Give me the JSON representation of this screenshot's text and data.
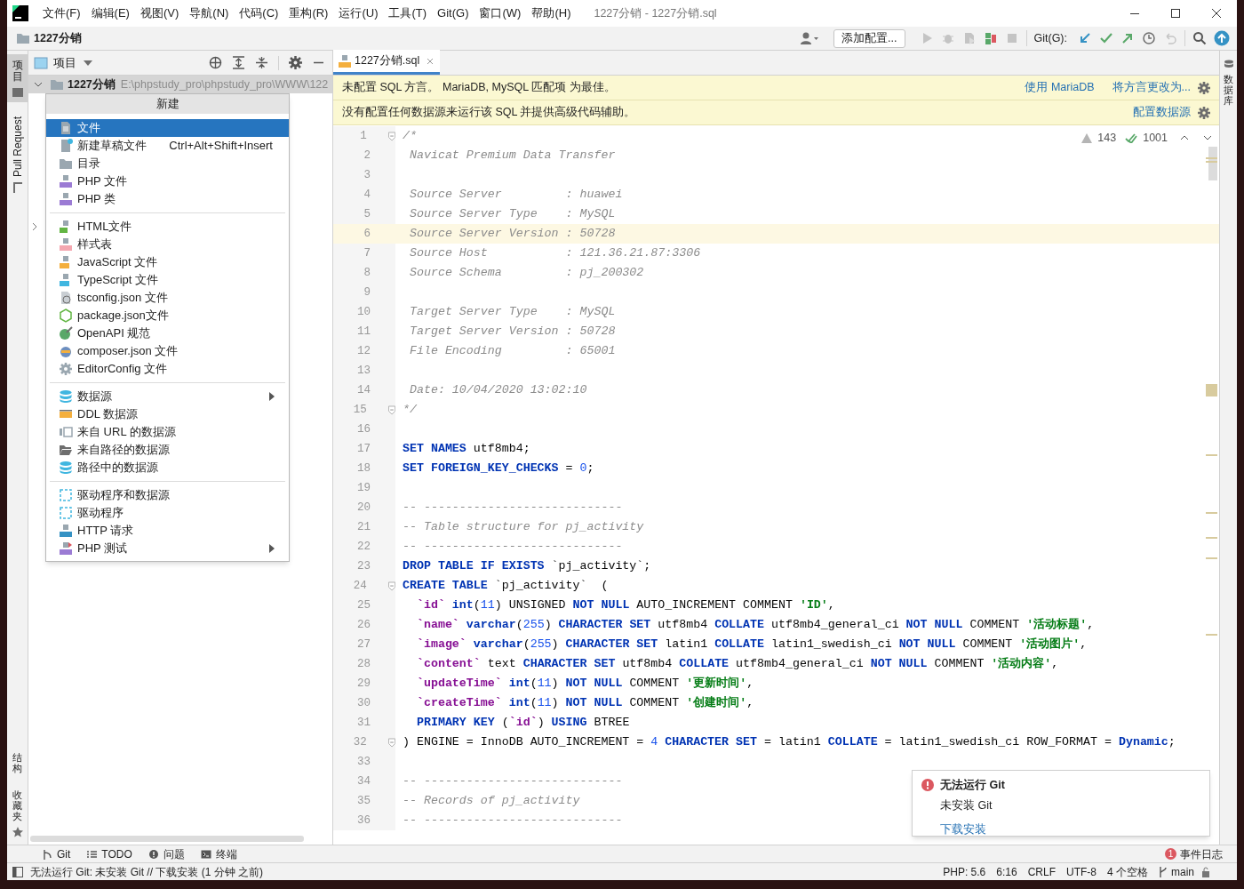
{
  "window": {
    "title": "1227分销 - 1227分销.sql"
  },
  "menu": [
    "文件(F)",
    "编辑(E)",
    "视图(V)",
    "导航(N)",
    "代码(C)",
    "重构(R)",
    "运行(U)",
    "工具(T)",
    "Git(G)",
    "窗口(W)",
    "帮助(H)"
  ],
  "nav_bar": {
    "project": "1227分销",
    "run_config": "添加配置...",
    "git_label": "Git(G):"
  },
  "left_stripe": {
    "top": [
      {
        "label": "项目",
        "vertical_cjk": true,
        "selected": true
      },
      {
        "label": "Pull Request",
        "vertical_cjk": false,
        "selected": false
      }
    ],
    "bottom": [
      {
        "label": "结构"
      },
      {
        "label": "收藏夹"
      }
    ]
  },
  "project_panel": {
    "title": "项目",
    "root": {
      "name": "1227分销",
      "path": "E:\\phpstudy_pro\\phpstudy_pro\\WWW\\122"
    }
  },
  "new_menu": {
    "title": "新建",
    "groups": [
      [
        {
          "kind": "file",
          "label": "文件",
          "selected": true,
          "submenu": false
        },
        {
          "kind": "scratch",
          "label": "新建草稿文件",
          "shortcut": "Ctrl+Alt+Shift+Insert",
          "selected": false,
          "submenu": false
        },
        {
          "kind": "folder",
          "label": "目录",
          "selected": false,
          "submenu": false
        },
        {
          "kind": "php",
          "label": "PHP 文件",
          "selected": false,
          "submenu": false
        },
        {
          "kind": "php",
          "label": "PHP 类",
          "selected": false,
          "submenu": false
        }
      ],
      [
        {
          "kind": "html",
          "label": "HTML文件",
          "selected": false,
          "submenu": false
        },
        {
          "kind": "css",
          "label": "样式表",
          "selected": false,
          "submenu": false
        },
        {
          "kind": "js",
          "label": "JavaScript 文件",
          "selected": false,
          "submenu": false
        },
        {
          "kind": "ts",
          "label": "TypeScript 文件",
          "selected": false,
          "submenu": false
        },
        {
          "kind": "tsconfig",
          "label": "tsconfig.json 文件",
          "selected": false,
          "submenu": false
        },
        {
          "kind": "nodejs",
          "label": "package.json文件",
          "selected": false,
          "submenu": false
        },
        {
          "kind": "openapi",
          "label": "OpenAPI 规范",
          "selected": false,
          "submenu": false
        },
        {
          "kind": "composer",
          "label": "composer.json 文件",
          "selected": false,
          "submenu": false
        },
        {
          "kind": "gear",
          "label": "EditorConfig 文件",
          "selected": false,
          "submenu": false
        }
      ],
      [
        {
          "kind": "database",
          "label": "数据源",
          "selected": false,
          "submenu": true
        },
        {
          "kind": "ddl",
          "label": "DDL 数据源",
          "selected": false,
          "submenu": false
        },
        {
          "kind": "url",
          "label": "来自 URL 的数据源",
          "selected": false,
          "submenu": false
        },
        {
          "kind": "openfolder",
          "label": "来自路径的数据源",
          "selected": false,
          "submenu": false
        },
        {
          "kind": "database",
          "label": "路径中的数据源",
          "selected": false,
          "submenu": false
        }
      ],
      [
        {
          "kind": "driver",
          "label": "驱动程序和数据源",
          "selected": false,
          "submenu": false
        },
        {
          "kind": "driver",
          "label": "驱动程序",
          "selected": false,
          "submenu": false
        },
        {
          "kind": "api",
          "label": "HTTP 请求",
          "selected": false,
          "submenu": false
        },
        {
          "kind": "phptest",
          "label": "PHP 测试",
          "selected": false,
          "submenu": true
        }
      ]
    ]
  },
  "editor": {
    "tab": {
      "label": "1227分销.sql",
      "selected": true
    },
    "banners": [
      {
        "text": "未配置 SQL 方言。 MariaDB, MySQL 匹配项 为最佳。",
        "actions": [
          "使用 MariaDB",
          "将方言更改为..."
        ]
      },
      {
        "text": "没有配置任何数据源来运行该 SQL 并提供高级代码辅助。",
        "actions": [
          "配置数据源"
        ]
      }
    ],
    "inspections": {
      "warnings": "143",
      "checks": "1001"
    },
    "lines": [
      {
        "number": "1",
        "current": false,
        "fold": true,
        "tokens": [
          {
            "kind": "comment",
            "text": "/*"
          }
        ]
      },
      {
        "number": "2",
        "current": false,
        "fold": false,
        "tokens": [
          {
            "kind": "comment",
            "text": " Navicat Premium Data Transfer"
          }
        ]
      },
      {
        "number": "3",
        "current": false,
        "fold": false
      },
      {
        "number": "4",
        "current": false,
        "fold": false,
        "tokens": [
          {
            "kind": "comment",
            "text": " Source Server         : huawei"
          }
        ]
      },
      {
        "number": "5",
        "current": false,
        "fold": false,
        "tokens": [
          {
            "kind": "comment",
            "text": " Source Server Type    : MySQL"
          }
        ]
      },
      {
        "number": "6",
        "current": true,
        "fold": false,
        "tokens": [
          {
            "kind": "comment",
            "text": " Source Server Version : 50728"
          }
        ]
      },
      {
        "number": "7",
        "current": false,
        "fold": false,
        "tokens": [
          {
            "kind": "comment",
            "text": " Source Host           : 121.36.21.87:3306"
          }
        ]
      },
      {
        "number": "8",
        "current": false,
        "fold": false,
        "tokens": [
          {
            "kind": "comment",
            "text": " Source Schema         : pj_200302"
          }
        ]
      },
      {
        "number": "9",
        "current": false,
        "fold": false
      },
      {
        "number": "10",
        "current": false,
        "fold": false,
        "tokens": [
          {
            "kind": "comment",
            "text": " Target Server Type    : MySQL"
          }
        ]
      },
      {
        "number": "11",
        "current": false,
        "fold": false,
        "tokens": [
          {
            "kind": "comment",
            "text": " Target Server Version : 50728"
          }
        ]
      },
      {
        "number": "12",
        "current": false,
        "fold": false,
        "tokens": [
          {
            "kind": "comment",
            "text": " File Encoding         : 65001"
          }
        ]
      },
      {
        "number": "13",
        "current": false,
        "fold": false
      },
      {
        "number": "14",
        "current": false,
        "fold": false,
        "tokens": [
          {
            "kind": "comment",
            "text": " Date: 10/04/2020 13:02:10"
          }
        ]
      },
      {
        "number": "15",
        "current": false,
        "fold": true,
        "tokens": [
          {
            "kind": "comment",
            "text": "*/"
          }
        ]
      },
      {
        "number": "16",
        "current": false,
        "fold": false
      },
      {
        "number": "17",
        "current": false,
        "fold": false,
        "tokens": [
          {
            "kind": "kw",
            "text": "SET NAMES"
          },
          {
            "kind": "text",
            "text": " utf8mb4;"
          }
        ]
      },
      {
        "number": "18",
        "current": false,
        "fold": false,
        "tokens": [
          {
            "kind": "kw",
            "text": "SET FOREIGN_KEY_CHECKS"
          },
          {
            "kind": "text",
            "text": " = "
          },
          {
            "kind": "num",
            "text": "0"
          },
          {
            "kind": "text",
            "text": ";"
          }
        ]
      },
      {
        "number": "19",
        "current": false,
        "fold": false
      },
      {
        "number": "20",
        "current": false,
        "fold": false,
        "tokens": [
          {
            "kind": "comment",
            "text": "-- ----------------------------"
          }
        ]
      },
      {
        "number": "21",
        "current": false,
        "fold": false,
        "tokens": [
          {
            "kind": "comment",
            "text": "-- Table structure for pj_activity"
          }
        ]
      },
      {
        "number": "22",
        "current": false,
        "fold": false,
        "tokens": [
          {
            "kind": "comment",
            "text": "-- ----------------------------"
          }
        ]
      },
      {
        "number": "23",
        "current": false,
        "fold": false,
        "tokens": [
          {
            "kind": "kw",
            "text": "DROP TABLE IF EXISTS"
          },
          {
            "kind": "text",
            "text": " `pj_activity`;"
          }
        ]
      },
      {
        "number": "24",
        "current": false,
        "fold": true,
        "tokens": [
          {
            "kind": "kw",
            "text": "CREATE TABLE"
          },
          {
            "kind": "text",
            "text": " `pj_activity`  ("
          }
        ]
      },
      {
        "number": "25",
        "current": false,
        "fold": false,
        "tokens": [
          {
            "kind": "ident",
            "text": "  `id`"
          },
          {
            "kind": "kw",
            "text": " int"
          },
          {
            "kind": "text",
            "text": "("
          },
          {
            "kind": "num",
            "text": "11"
          },
          {
            "kind": "text",
            "text": ") UNSIGNED "
          },
          {
            "kind": "kw",
            "text": "NOT NULL"
          },
          {
            "kind": "text",
            "text": " AUTO_INCREMENT COMMENT "
          },
          {
            "kind": "str",
            "text": "'ID'"
          },
          {
            "kind": "text",
            "text": ","
          }
        ]
      },
      {
        "number": "26",
        "current": false,
        "fold": false,
        "tokens": [
          {
            "kind": "ident",
            "text": "  `name`"
          },
          {
            "kind": "kw",
            "text": " varchar"
          },
          {
            "kind": "text",
            "text": "("
          },
          {
            "kind": "num",
            "text": "255"
          },
          {
            "kind": "text",
            "text": ") "
          },
          {
            "kind": "kw",
            "text": "CHARACTER SET"
          },
          {
            "kind": "text",
            "text": " utf8mb4 "
          },
          {
            "kind": "kw",
            "text": "COLLATE"
          },
          {
            "kind": "text",
            "text": " utf8mb4_general_ci "
          },
          {
            "kind": "kw",
            "text": "NOT NULL"
          },
          {
            "kind": "text",
            "text": " COMMENT "
          },
          {
            "kind": "str",
            "text": "'活动标题'"
          },
          {
            "kind": "text",
            "text": ","
          }
        ]
      },
      {
        "number": "27",
        "current": false,
        "fold": false,
        "tokens": [
          {
            "kind": "ident",
            "text": "  `image`"
          },
          {
            "kind": "kw",
            "text": " varchar"
          },
          {
            "kind": "text",
            "text": "("
          },
          {
            "kind": "num",
            "text": "255"
          },
          {
            "kind": "text",
            "text": ") "
          },
          {
            "kind": "kw",
            "text": "CHARACTER SET"
          },
          {
            "kind": "text",
            "text": " latin1 "
          },
          {
            "kind": "kw",
            "text": "COLLATE"
          },
          {
            "kind": "text",
            "text": " latin1_swedish_ci "
          },
          {
            "kind": "kw",
            "text": "NOT NULL"
          },
          {
            "kind": "text",
            "text": " COMMENT "
          },
          {
            "kind": "str",
            "text": "'活动图片'"
          },
          {
            "kind": "text",
            "text": ","
          }
        ]
      },
      {
        "number": "28",
        "current": false,
        "fold": false,
        "tokens": [
          {
            "kind": "ident",
            "text": "  `content`"
          },
          {
            "kind": "text",
            "text": " text "
          },
          {
            "kind": "kw",
            "text": "CHARACTER SET"
          },
          {
            "kind": "text",
            "text": " utf8mb4 "
          },
          {
            "kind": "kw",
            "text": "COLLATE"
          },
          {
            "kind": "text",
            "text": " utf8mb4_general_ci "
          },
          {
            "kind": "kw",
            "text": "NOT NULL"
          },
          {
            "kind": "text",
            "text": " COMMENT "
          },
          {
            "kind": "str",
            "text": "'活动内容'"
          },
          {
            "kind": "text",
            "text": ","
          }
        ]
      },
      {
        "number": "29",
        "current": false,
        "fold": false,
        "tokens": [
          {
            "kind": "ident",
            "text": "  `updateTime`"
          },
          {
            "kind": "kw",
            "text": " int"
          },
          {
            "kind": "text",
            "text": "("
          },
          {
            "kind": "num",
            "text": "11"
          },
          {
            "kind": "text",
            "text": ") "
          },
          {
            "kind": "kw",
            "text": "NOT NULL"
          },
          {
            "kind": "text",
            "text": " COMMENT "
          },
          {
            "kind": "str",
            "text": "'更新时间'"
          },
          {
            "kind": "text",
            "text": ","
          }
        ]
      },
      {
        "number": "30",
        "current": false,
        "fold": false,
        "tokens": [
          {
            "kind": "ident",
            "text": "  `createTime`"
          },
          {
            "kind": "kw",
            "text": " int"
          },
          {
            "kind": "text",
            "text": "("
          },
          {
            "kind": "num",
            "text": "11"
          },
          {
            "kind": "text",
            "text": ") "
          },
          {
            "kind": "kw",
            "text": "NOT NULL"
          },
          {
            "kind": "text",
            "text": " COMMENT "
          },
          {
            "kind": "str",
            "text": "'创建时间'"
          },
          {
            "kind": "text",
            "text": ","
          }
        ]
      },
      {
        "number": "31",
        "current": false,
        "fold": false,
        "tokens": [
          {
            "kind": "kw",
            "text": "  PRIMARY KEY"
          },
          {
            "kind": "text",
            "text": " ("
          },
          {
            "kind": "ident",
            "text": "`id`"
          },
          {
            "kind": "text",
            "text": ") "
          },
          {
            "kind": "kw",
            "text": "USING"
          },
          {
            "kind": "text",
            "text": " BTREE"
          }
        ]
      },
      {
        "number": "32",
        "current": false,
        "fold": true,
        "tokens": [
          {
            "kind": "text",
            "text": ") ENGINE = InnoDB AUTO_INCREMENT = "
          },
          {
            "kind": "num",
            "text": "4"
          },
          {
            "kind": "kw",
            "text": " CHARACTER SET"
          },
          {
            "kind": "text",
            "text": " = latin1 "
          },
          {
            "kind": "kw",
            "text": "COLLATE"
          },
          {
            "kind": "text",
            "text": " = latin1_swedish_ci ROW_FORMAT = "
          },
          {
            "kind": "kw",
            "text": "Dynamic"
          },
          {
            "kind": "text",
            "text": ";"
          }
        ]
      },
      {
        "number": "33",
        "current": false,
        "fold": false
      },
      {
        "number": "34",
        "current": false,
        "fold": false,
        "tokens": [
          {
            "kind": "comment",
            "text": "-- ----------------------------"
          }
        ]
      },
      {
        "number": "35",
        "current": false,
        "fold": false,
        "tokens": [
          {
            "kind": "comment",
            "text": "-- Records of pj_activity"
          }
        ]
      },
      {
        "number": "36",
        "current": false,
        "fold": false,
        "tokens": [
          {
            "kind": "comment",
            "text": "-- ----------------------------"
          }
        ]
      }
    ]
  },
  "notification": {
    "title": "无法运行 Git",
    "body": "未安装 Git",
    "link": "下载安装"
  },
  "right_stripe": {
    "label": "数据库"
  },
  "tool_windows": [
    {
      "kind": "git",
      "label": "Git"
    },
    {
      "kind": "todo",
      "label": "TODO"
    },
    {
      "kind": "problems",
      "label": "问题"
    },
    {
      "kind": "terminal",
      "label": "终端"
    }
  ],
  "event_log": {
    "label": "事件日志",
    "count": "1"
  },
  "status_bar": {
    "message": "无法运行 Git: 未安装 Git // 下载安装 (1 分钟 之前)",
    "items": [
      {
        "kind": "text",
        "label": "PHP: 5.6"
      },
      {
        "kind": "text",
        "label": "6:16"
      },
      {
        "kind": "text",
        "label": "CRLF"
      },
      {
        "kind": "text",
        "label": "UTF-8"
      },
      {
        "kind": "text",
        "label": "4 个空格"
      },
      {
        "kind": "branch",
        "label": "main"
      }
    ]
  }
}
